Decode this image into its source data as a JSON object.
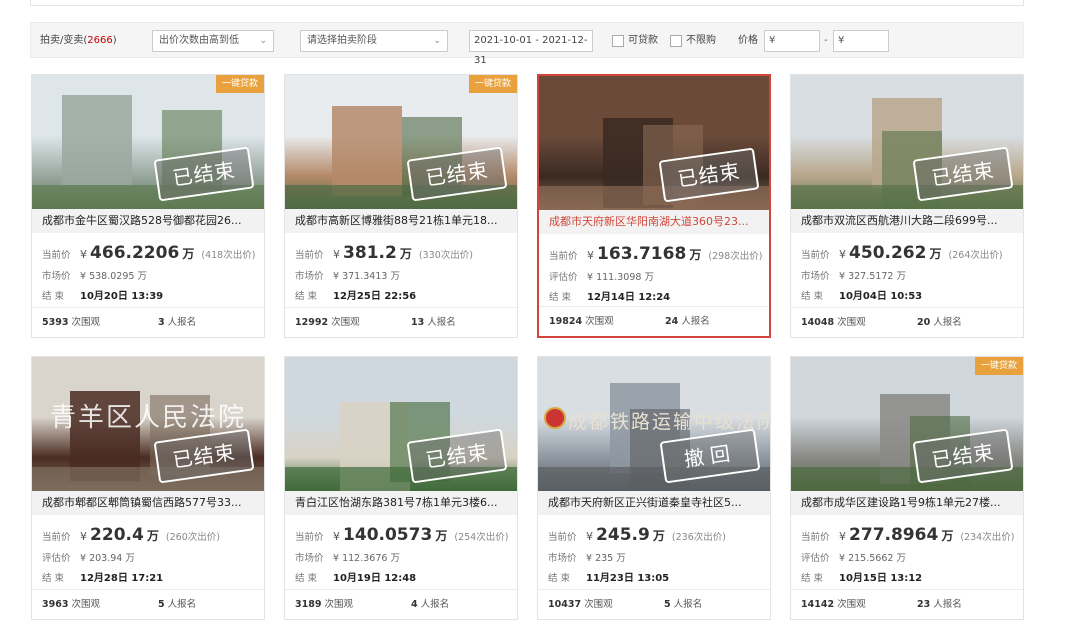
{
  "filter": {
    "title": "拍卖/变卖",
    "count": "2666",
    "sort": "出价次数由高到低",
    "stage": "请选择拍卖阶段",
    "date_range": "2021-10-01 - 2021-12-31",
    "loan_label": "可贷款",
    "unlimited_label": "不限购",
    "price_label": "价格",
    "price_min": "¥",
    "price_dash": "-",
    "price_max": "¥"
  },
  "labels": {
    "current": "当前价",
    "market": "市场价",
    "appraised": "评估价",
    "end": "结 束",
    "views_suffix": "次围观",
    "signup_suffix": "人报名",
    "unit": "万",
    "yuan": "¥",
    "bids_open": "(",
    "bids_close": "次出价)"
  },
  "cards": [
    {
      "title": "成都市金牛区蜀汉路528号御都花园26...",
      "badge": "一键贷款",
      "stamp": "已结束",
      "watermark": "",
      "price": "466.2206",
      "bids": "418",
      "ref_label": "市场价",
      "ref_price": "538.0295",
      "end": "10月20日 13:39",
      "views": "5393",
      "signups": "3"
    },
    {
      "title": "成都市高新区博雅街88号21栋1单元18...",
      "badge": "一键贷款",
      "stamp": "已结束",
      "watermark": "",
      "price": "381.2",
      "bids": "330",
      "ref_label": "市场价",
      "ref_price": "371.3413",
      "end": "12月25日 22:56",
      "views": "12992",
      "signups": "13"
    },
    {
      "title": "成都市天府新区华阳南湖大道360号23...",
      "badge": "",
      "stamp": "已结束",
      "watermark": "",
      "price": "163.7168",
      "bids": "298",
      "ref_label": "评估价",
      "ref_price": "111.3098",
      "end": "12月14日 12:24",
      "views": "19824",
      "signups": "24"
    },
    {
      "title": "成都市双流区西航港川大路二段699号...",
      "badge": "",
      "stamp": "已结束",
      "watermark": "",
      "price": "450.262",
      "bids": "264",
      "ref_label": "市场价",
      "ref_price": "327.5172",
      "end": "10月04日 10:53",
      "views": "14048",
      "signups": "20"
    },
    {
      "title": "成都市郫都区郫筒镇蜀信西路577号33...",
      "badge": "",
      "stamp": "已结束",
      "watermark": "青羊区人民法院",
      "price": "220.4",
      "bids": "260",
      "ref_label": "评估价",
      "ref_price": "203.94",
      "end": "12月28日 17:21",
      "views": "3963",
      "signups": "5"
    },
    {
      "title": "青白江区怡湖东路381号7栋1单元3楼6...",
      "badge": "",
      "stamp": "已结束",
      "watermark": "",
      "price": "140.0573",
      "bids": "254",
      "ref_label": "市场价",
      "ref_price": "112.3676",
      "end": "10月19日 12:48",
      "views": "3189",
      "signups": "4"
    },
    {
      "title": "成都市天府新区正兴街道秦皇寺社区5...",
      "badge": "",
      "stamp": "撤回",
      "watermark": "成都铁路运输中级法院",
      "price": "245.9",
      "bids": "236",
      "ref_label": "市场价",
      "ref_price": "235",
      "end": "11月23日 13:05",
      "views": "10437",
      "signups": "5"
    },
    {
      "title": "成都市成华区建设路1号9栋1单元27楼...",
      "badge": "一键贷款",
      "stamp": "已结束",
      "watermark": "",
      "price": "277.8964",
      "bids": "234",
      "ref_label": "评估价",
      "ref_price": "215.5662",
      "end": "10月15日 13:12",
      "views": "14142",
      "signups": "23"
    }
  ]
}
